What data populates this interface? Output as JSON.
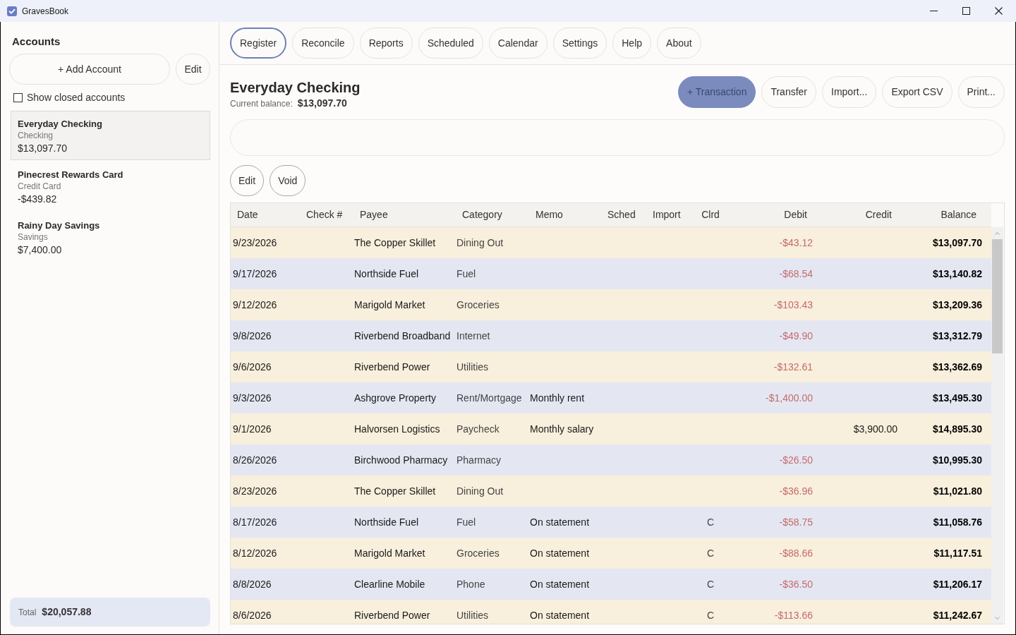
{
  "window": {
    "title": "GravesBook"
  },
  "sidebar": {
    "heading": "Accounts",
    "add_button": "+ Add Account",
    "edit_button": "Edit",
    "show_closed": {
      "label": "Show closed accounts",
      "checked": false
    },
    "accounts": [
      {
        "name": "Everyday Checking",
        "type": "Checking",
        "balance": "$13,097.70",
        "selected": true
      },
      {
        "name": "Pinecrest Rewards Card",
        "type": "Credit Card",
        "balance": "-$439.82",
        "selected": false
      },
      {
        "name": "Rainy Day Savings",
        "type": "Savings",
        "balance": "$7,400.00",
        "selected": false
      }
    ],
    "total": {
      "label": "Total",
      "value": "$20,057.88"
    }
  },
  "nav_tabs": [
    {
      "label": "Register",
      "selected": true
    },
    {
      "label": "Reconcile",
      "selected": false
    },
    {
      "label": "Reports",
      "selected": false
    },
    {
      "label": "Scheduled",
      "selected": false
    },
    {
      "label": "Calendar",
      "selected": false
    },
    {
      "label": "Settings",
      "selected": false
    },
    {
      "label": "Help",
      "selected": false
    },
    {
      "label": "About",
      "selected": false
    }
  ],
  "account_header": {
    "title": "Everyday Checking",
    "balance_label": "Current balance:",
    "balance": "$13,097.70"
  },
  "actions": [
    {
      "label": "+ Transaction",
      "kind": "primary"
    },
    {
      "label": "Transfer",
      "kind": "secondary"
    },
    {
      "label": "Import...",
      "kind": "secondary"
    },
    {
      "label": "Export CSV",
      "kind": "secondary"
    },
    {
      "label": "Print...",
      "kind": "secondary"
    }
  ],
  "row_actions": [
    "Edit",
    "Void"
  ],
  "table": {
    "columns": [
      "Date",
      "Check #",
      "Payee",
      "Category",
      "Memo",
      "Sched",
      "Import",
      "Clrd",
      "Debit",
      "Credit",
      "Balance"
    ],
    "rows": [
      {
        "date": "9/23/2026",
        "payee": "The Copper Skillet",
        "category": "Dining Out",
        "debit": "-$43.12",
        "balance": "$13,097.70"
      },
      {
        "date": "9/17/2026",
        "payee": "Northside Fuel",
        "category": "Fuel",
        "debit": "-$68.54",
        "balance": "$13,140.82"
      },
      {
        "date": "9/12/2026",
        "payee": "Marigold Market",
        "category": "Groceries",
        "debit": "-$103.43",
        "balance": "$13,209.36"
      },
      {
        "date": "9/8/2026",
        "payee": "Riverbend Broadband",
        "category": "Internet",
        "debit": "-$49.90",
        "balance": "$13,312.79"
      },
      {
        "date": "9/6/2026",
        "payee": "Riverbend Power",
        "category": "Utilities",
        "debit": "-$132.61",
        "balance": "$13,362.69"
      },
      {
        "date": "9/3/2026",
        "payee": "Ashgrove Property",
        "category": "Rent/Mortgage",
        "memo": "Monthly rent",
        "debit": "-$1,400.00",
        "balance": "$13,495.30"
      },
      {
        "date": "9/1/2026",
        "payee": "Halvorsen Logistics",
        "category": "Paycheck",
        "memo": "Monthly salary",
        "credit": "$3,900.00",
        "balance": "$14,895.30"
      },
      {
        "date": "8/26/2026",
        "payee": "Birchwood Pharmacy",
        "category": "Pharmacy",
        "debit": "-$26.50",
        "balance": "$10,995.30"
      },
      {
        "date": "8/23/2026",
        "payee": "The Copper Skillet",
        "category": "Dining Out",
        "debit": "-$36.96",
        "balance": "$11,021.80"
      },
      {
        "date": "8/17/2026",
        "payee": "Northside Fuel",
        "category": "Fuel",
        "memo": "On statement",
        "cleared": "C",
        "debit": "-$58.75",
        "balance": "$11,058.76"
      },
      {
        "date": "8/12/2026",
        "payee": "Marigold Market",
        "category": "Groceries",
        "memo": "On statement",
        "cleared": "C",
        "debit": "-$88.66",
        "balance": "$11,117.51"
      },
      {
        "date": "8/8/2026",
        "payee": "Clearline Mobile",
        "category": "Phone",
        "memo": "On statement",
        "cleared": "C",
        "debit": "-$36.50",
        "balance": "$11,206.17"
      },
      {
        "date": "8/6/2026",
        "payee": "Riverbend Power",
        "category": "Utilities",
        "memo": "On statement",
        "cleared": "C",
        "debit": "-$113.66",
        "balance": "$11,242.67"
      }
    ]
  }
}
